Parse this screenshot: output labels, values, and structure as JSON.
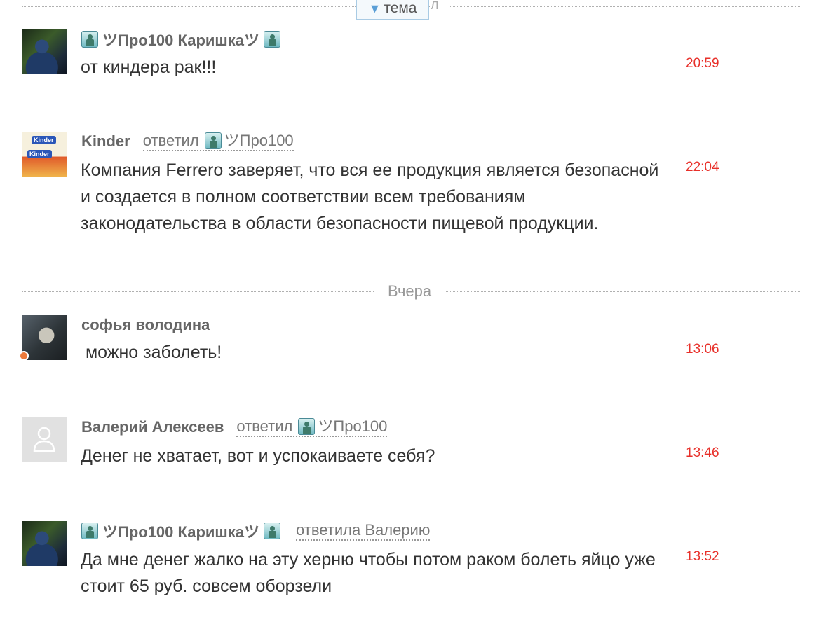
{
  "topic_divider": {
    "label": "тема",
    "arrow": "▼",
    "trail": "л"
  },
  "date_divider": {
    "label": "Вчера"
  },
  "messages": [
    {
      "author_left": "ツПро100 Каришкаツ",
      "text": "от киндера рак!!!",
      "time": "20:59"
    },
    {
      "author": "Kinder",
      "reply_label": "ответил",
      "reply_to": "ツПро100",
      "text": "Компания Ferrero заверяет, что вся ее продукция является безопасной и создается в полном соответствии всем требованиям законодательства в области безопасности пищевой продукции.",
      "time": "22:04",
      "avatar_text_1": "Kinder",
      "avatar_text_2": "Kinder"
    },
    {
      "author": "софья володина",
      "text": " можно заболеть!",
      "time": "13:06"
    },
    {
      "author": "Валерий Алексеев",
      "reply_label": "ответил",
      "reply_to": "ツПро100",
      "text": "Денег не хватает, вот и успокаиваете себя?",
      "time": "13:46"
    },
    {
      "author_left": "ツПро100 Каришкаツ",
      "reply_label": "ответила Валерию",
      "text": "Да мне денег жалко на эту херню чтобы потом раком болеть яйцо уже стоит 65 руб. совсем оборзели",
      "time": "13:52"
    }
  ],
  "colors": {
    "time": "#e8302a",
    "author": "#666666",
    "online": "#ee7a3a",
    "topic_border": "#a9cbe4"
  },
  "icons": {
    "statue": "statue-of-liberty-icon",
    "placeholder": "user-placeholder-icon",
    "arrow": "triangle-down-icon"
  }
}
